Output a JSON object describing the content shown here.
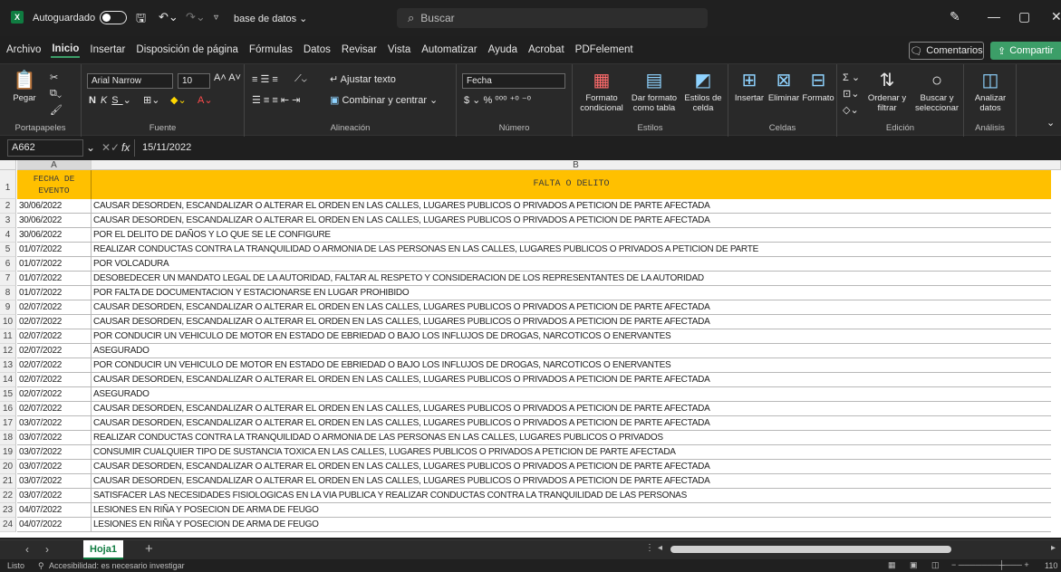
{
  "titlebar": {
    "logo": "X",
    "autosave_label": "Autoguardado",
    "filename": "base de datos ⌄",
    "search_placeholder": "Buscar",
    "search_icon": "search-icon",
    "minimize": "—",
    "maximize": "▢",
    "close": "✕"
  },
  "menu": {
    "items": [
      "Archivo",
      "Inicio",
      "Insertar",
      "Disposición de página",
      "Fórmulas",
      "Datos",
      "Revisar",
      "Vista",
      "Automatizar",
      "Ayuda",
      "Acrobat",
      "PDFelement"
    ],
    "active": "Inicio",
    "comments": "Comentarios",
    "share": "Compartir"
  },
  "ribbon": {
    "clipboard": {
      "paste": "Pegar",
      "label": "Portapapeles"
    },
    "font": {
      "name": "Arial Narrow",
      "size": "10",
      "label": "Fuente"
    },
    "alignment": {
      "wrap": "Ajustar texto",
      "merge": "Combinar y centrar",
      "label": "Alineación"
    },
    "number": {
      "format": "Fecha",
      "label": "Número"
    },
    "styles": {
      "conditional": "Formato condicional",
      "table": "Dar formato como tabla",
      "cell": "Estilos de celda",
      "label": "Estilos"
    },
    "cells": {
      "insert": "Insertar",
      "delete": "Eliminar",
      "format": "Formato",
      "label": "Celdas"
    },
    "editing": {
      "sort": "Ordenar y filtrar",
      "find": "Buscar y seleccionar",
      "label": "Edición"
    },
    "analysis": {
      "analyze": "Analizar datos",
      "label": "Análisis"
    }
  },
  "formula_bar": {
    "name_box": "A662",
    "fx": "fx",
    "value": "15/11/2022"
  },
  "grid": {
    "columns": [
      "A",
      "B"
    ],
    "header_a": "FECHA DE EVENTO",
    "header_b": "FALTA O DELITO",
    "rows": [
      {
        "n": "2",
        "a": "30/06/2022",
        "b": "CAUSAR DESORDEN, ESCANDALIZAR O ALTERAR EL ORDEN EN LAS CALLES, LUGARES PUBLICOS O PRIVADOS A PETICION DE PARTE AFECTADA"
      },
      {
        "n": "3",
        "a": "30/06/2022",
        "b": "CAUSAR DESORDEN, ESCANDALIZAR O ALTERAR EL ORDEN EN LAS CALLES, LUGARES PUBLICOS O PRIVADOS A PETICION DE PARTE AFECTADA"
      },
      {
        "n": "4",
        "a": "30/06/2022",
        "b": "POR EL DELITO DE DAÑOS Y LO QUE SE LE CONFIGURE"
      },
      {
        "n": "5",
        "a": "01/07/2022",
        "b": "REALIZAR CONDUCTAS CONTRA LA TRANQUILIDAD O ARMONIA DE LAS PERSONAS EN LAS CALLES, LUGARES PUBLICOS O PRIVADOS A PETICION DE PARTE"
      },
      {
        "n": "6",
        "a": "01/07/2022",
        "b": "POR VOLCADURA"
      },
      {
        "n": "7",
        "a": "01/07/2022",
        "b": "DESOBEDECER UN MANDATO LEGAL DE LA AUTORIDAD, FALTAR AL RESPETO Y CONSIDERACION DE LOS REPRESENTANTES DE LA AUTORIDAD"
      },
      {
        "n": "8",
        "a": "01/07/2022",
        "b": "POR FALTA DE DOCUMENTACION Y ESTACIONARSE EN LUGAR PROHIBIDO"
      },
      {
        "n": "9",
        "a": "02/07/2022",
        "b": "CAUSAR DESORDEN, ESCANDALIZAR O ALTERAR EL ORDEN EN LAS CALLES, LUGARES PUBLICOS O PRIVADOS A PETICION DE PARTE AFECTADA"
      },
      {
        "n": "10",
        "a": "02/07/2022",
        "b": "CAUSAR DESORDEN, ESCANDALIZAR O ALTERAR EL ORDEN EN LAS CALLES, LUGARES PUBLICOS O PRIVADOS A PETICION DE PARTE AFECTADA"
      },
      {
        "n": "11",
        "a": "02/07/2022",
        "b": "POR CONDUCIR UN VEHICULO DE MOTOR EN ESTADO DE EBRIEDAD O BAJO LOS INFLUJOS DE DROGAS, NARCOTICOS O ENERVANTES"
      },
      {
        "n": "12",
        "a": "02/07/2022",
        "b": "ASEGURADO"
      },
      {
        "n": "13",
        "a": "02/07/2022",
        "b": "POR CONDUCIR UN VEHICULO DE MOTOR EN ESTADO DE EBRIEDAD O BAJO LOS INFLUJOS DE DROGAS, NARCOTICOS O ENERVANTES"
      },
      {
        "n": "14",
        "a": "02/07/2022",
        "b": "CAUSAR DESORDEN, ESCANDALIZAR O ALTERAR EL ORDEN EN LAS CALLES, LUGARES PUBLICOS O PRIVADOS A PETICION DE PARTE AFECTADA"
      },
      {
        "n": "15",
        "a": "02/07/2022",
        "b": "ASEGURADO"
      },
      {
        "n": "16",
        "a": "02/07/2022",
        "b": "CAUSAR DESORDEN, ESCANDALIZAR O ALTERAR EL ORDEN EN LAS CALLES, LUGARES PUBLICOS O PRIVADOS A PETICION DE PARTE AFECTADA"
      },
      {
        "n": "17",
        "a": "03/07/2022",
        "b": "CAUSAR DESORDEN, ESCANDALIZAR O ALTERAR EL ORDEN EN LAS CALLES, LUGARES PUBLICOS O PRIVADOS A PETICION DE PARTE AFECTADA"
      },
      {
        "n": "18",
        "a": "03/07/2022",
        "b": "REALIZAR CONDUCTAS CONTRA LA TRANQUILIDAD O ARMONIA DE LAS PERSONAS EN LAS CALLES, LUGARES PUBLICOS O PRIVADOS"
      },
      {
        "n": "19",
        "a": "03/07/2022",
        "b": "CONSUMIR CUALQUIER TIPO DE SUSTANCIA TOXICA EN LAS CALLES, LUGARES PUBLICOS O PRIVADOS A PETICION DE PARTE AFECTADA"
      },
      {
        "n": "20",
        "a": "03/07/2022",
        "b": "CAUSAR DESORDEN, ESCANDALIZAR O ALTERAR EL ORDEN EN LAS CALLES, LUGARES PUBLICOS O PRIVADOS A PETICION DE PARTE AFECTADA"
      },
      {
        "n": "21",
        "a": "03/07/2022",
        "b": "CAUSAR DESORDEN, ESCANDALIZAR O ALTERAR EL ORDEN EN LAS CALLES, LUGARES PUBLICOS O PRIVADOS A PETICION DE PARTE AFECTADA"
      },
      {
        "n": "22",
        "a": "03/07/2022",
        "b": "SATISFACER LAS NECESIDADES FISIOLOGICAS EN LA VIA PUBLICA Y REALIZAR CONDUCTAS CONTRA LA TRANQUILIDAD DE LAS PERSONAS"
      },
      {
        "n": "23",
        "a": "04/07/2022",
        "b": "LESIONES EN RIÑA Y POSECION DE ARMA DE FEUGO"
      },
      {
        "n": "24",
        "a": "04/07/2022",
        "b": "LESIONES EN RIÑA Y POSECION DE ARMA DE FEUGO"
      }
    ]
  },
  "sheets": {
    "active": "Hoja1",
    "add": "+"
  },
  "status": {
    "ready": "Listo",
    "accessibility": "Accesibilidad: es necesario investigar",
    "zoom": "110"
  },
  "colors": {
    "header_fill": "#ffc000",
    "accent": "#3c9e68",
    "excel_green": "#107c41"
  }
}
